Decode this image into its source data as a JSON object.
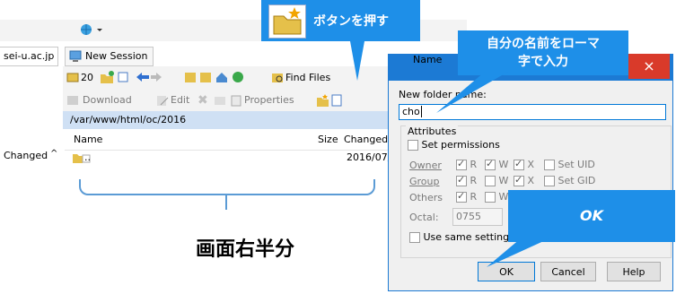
{
  "colors": {
    "callout": "#1e8fe8",
    "titlebar": "#1c7ad4",
    "close": "#d93a2a",
    "path_bar": "#cfe0f4"
  },
  "callouts": {
    "button": "ボタンを押す",
    "name": "自分の名前をローマ字で入力",
    "name_line1": "自分の名前をローマ",
    "name_line2": "字で入力",
    "ok": "OK"
  },
  "caption": "画面右半分",
  "app": {
    "left_tab": "sei-u.ac.jp",
    "new_session": "New Session",
    "toolbar1_marker": "20",
    "find_files": "Find Files",
    "download": "Download",
    "edit": "Edit",
    "properties": "Properties",
    "path": "/var/www/html/oc/2016",
    "columns": [
      "Name",
      "Size",
      "Changed"
    ],
    "left_column": "Changed",
    "rows": [
      {
        "name": "..",
        "changed": "2016/07/"
      }
    ]
  },
  "dialog": {
    "title": "New folder name",
    "name_label": "New folder name:",
    "name_value": "cho",
    "attributes_label": "Attributes",
    "set_permissions": "Set permissions",
    "owner": "Owner",
    "group": "Group",
    "others": "Others",
    "perm_r": "R",
    "perm_w": "W",
    "perm_x": "X",
    "set_uid": "Set UID",
    "set_gid": "Set GID",
    "octal_label": "Octal:",
    "octal_value": "0755",
    "use_same": "Use same settings next time",
    "ok": "OK",
    "cancel": "Cancel",
    "help": "Help"
  },
  "behind_text": "Name"
}
